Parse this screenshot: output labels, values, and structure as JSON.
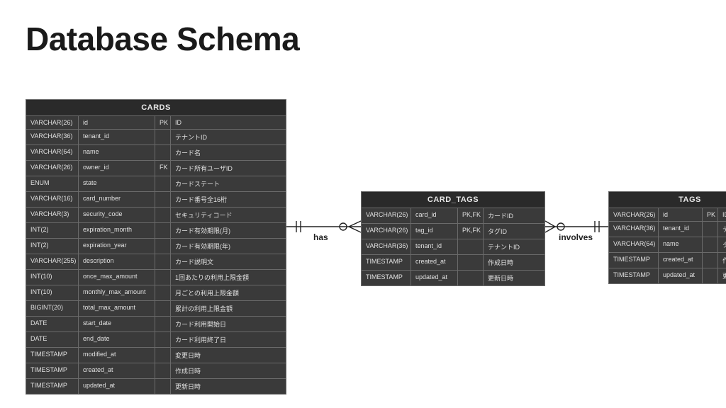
{
  "title": "Database Schema",
  "relations": {
    "has": "has",
    "involves": "involves"
  },
  "tables": {
    "cards": {
      "name": "CARDS",
      "rows": [
        {
          "type": "VARCHAR(26)",
          "name": "id",
          "key": "PK",
          "desc": "ID"
        },
        {
          "type": "VARCHAR(36)",
          "name": "tenant_id",
          "key": "",
          "desc": "テナントID"
        },
        {
          "type": "VARCHAR(64)",
          "name": "name",
          "key": "",
          "desc": "カード名"
        },
        {
          "type": "VARCHAR(26)",
          "name": "owner_id",
          "key": "FK",
          "desc": "カード所有ユーザID"
        },
        {
          "type": "ENUM",
          "name": "state",
          "key": "",
          "desc": "カードステート"
        },
        {
          "type": "VARCHAR(16)",
          "name": "card_number",
          "key": "",
          "desc": "カード番号全16桁"
        },
        {
          "type": "VARCHAR(3)",
          "name": "security_code",
          "key": "",
          "desc": "セキュリティコード"
        },
        {
          "type": "INT(2)",
          "name": "expiration_month",
          "key": "",
          "desc": "カード有効期限(月)"
        },
        {
          "type": "INT(2)",
          "name": "expiration_year",
          "key": "",
          "desc": "カード有効期限(年)"
        },
        {
          "type": "VARCHAR(255)",
          "name": "description",
          "key": "",
          "desc": "カード説明文"
        },
        {
          "type": "INT(10)",
          "name": "once_max_amount",
          "key": "",
          "desc": "1回あたりの利用上限金額"
        },
        {
          "type": "INT(10)",
          "name": "monthly_max_amount",
          "key": "",
          "desc": "月ごとの利用上限金額"
        },
        {
          "type": "BIGINT(20)",
          "name": "total_max_amount",
          "key": "",
          "desc": "累計の利用上限金額"
        },
        {
          "type": "DATE",
          "name": "start_date",
          "key": "",
          "desc": "カード利用開始日"
        },
        {
          "type": "DATE",
          "name": "end_date",
          "key": "",
          "desc": "カード利用終了日"
        },
        {
          "type": "TIMESTAMP",
          "name": "modified_at",
          "key": "",
          "desc": "変更日時"
        },
        {
          "type": "TIMESTAMP",
          "name": "created_at",
          "key": "",
          "desc": "作成日時"
        },
        {
          "type": "TIMESTAMP",
          "name": "updated_at",
          "key": "",
          "desc": "更新日時"
        }
      ]
    },
    "card_tags": {
      "name": "CARD_TAGS",
      "rows": [
        {
          "type": "VARCHAR(26)",
          "name": "card_id",
          "key": "PK,FK",
          "desc": "カードID"
        },
        {
          "type": "VARCHAR(26)",
          "name": "tag_id",
          "key": "PK,FK",
          "desc": "タグID"
        },
        {
          "type": "VARCHAR(36)",
          "name": "tenant_id",
          "key": "",
          "desc": "テナントID"
        },
        {
          "type": "TIMESTAMP",
          "name": "created_at",
          "key": "",
          "desc": "作成日時"
        },
        {
          "type": "TIMESTAMP",
          "name": "updated_at",
          "key": "",
          "desc": "更新日時"
        }
      ]
    },
    "tags": {
      "name": "TAGS",
      "rows": [
        {
          "type": "VARCHAR(26)",
          "name": "id",
          "key": "PK",
          "desc": "ID"
        },
        {
          "type": "VARCHAR(36)",
          "name": "tenant_id",
          "key": "",
          "desc": "テナントID"
        },
        {
          "type": "VARCHAR(64)",
          "name": "name",
          "key": "",
          "desc": "タグ名"
        },
        {
          "type": "TIMESTAMP",
          "name": "created_at",
          "key": "",
          "desc": "作成日時"
        },
        {
          "type": "TIMESTAMP",
          "name": "updated_at",
          "key": "",
          "desc": "更新日時"
        }
      ]
    }
  }
}
